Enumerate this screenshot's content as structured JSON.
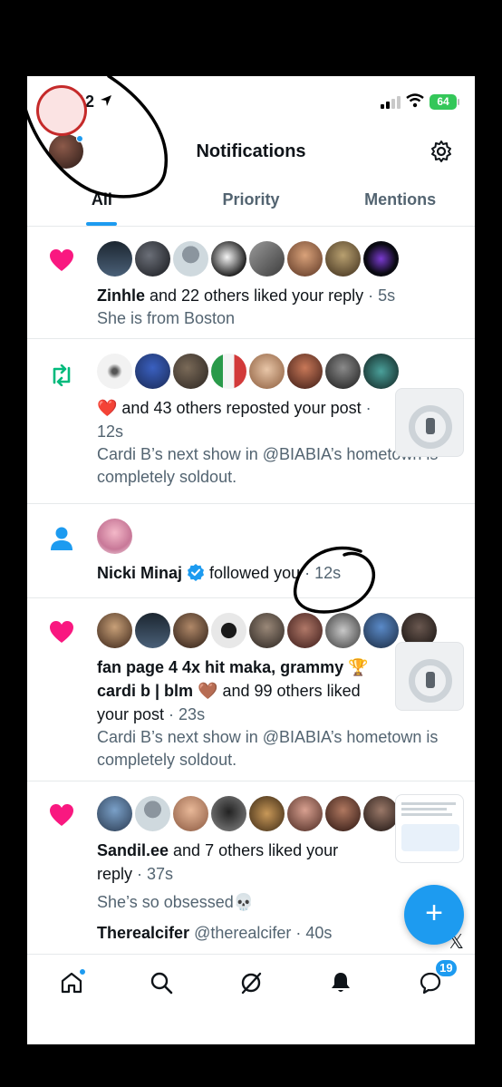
{
  "status_bar": {
    "time": "17:12",
    "battery": "64"
  },
  "header": {
    "title": "Notifications"
  },
  "tabs": [
    {
      "label": "All",
      "active": true
    },
    {
      "label": "Priority",
      "active": false
    },
    {
      "label": "Mentions",
      "active": false
    }
  ],
  "notifications": [
    {
      "type": "like",
      "icon": "heart-icon",
      "actor": "Zinhle",
      "text": " and 22 others liked your reply",
      "time": "5s",
      "sub": "She is from Boston"
    },
    {
      "type": "repost",
      "icon": "repost-icon",
      "actor": "❤️",
      "text": " and 43 others reposted your post",
      "time": "12s",
      "sub": "Cardi B’s next show in @BIABIA’s hometown is completely soldout."
    },
    {
      "type": "follow",
      "icon": "person-icon",
      "actor": "Nicki Minaj",
      "text": " followed you",
      "time": "12s"
    },
    {
      "type": "like",
      "icon": "heart-icon",
      "actor": "fan page 4 4x hit maka, grammy 🏆 cardi b | blm 🤎",
      "text": " and 99 others liked your post",
      "time": "23s",
      "sub": "Cardi B’s next show in @BIABIA’s hometown is completely soldout."
    },
    {
      "type": "like",
      "icon": "heart-icon",
      "actor": "Sandil.ee",
      "text": " and 7 others liked your reply",
      "time": "37s",
      "sub": "She’s so obsessed💀"
    }
  ],
  "peek_post": {
    "name": "Therealcifer",
    "handle": "@therealcifer",
    "time": "40s"
  },
  "fab": {
    "label": "+"
  },
  "bottom_nav": {
    "messages_badge": "19"
  },
  "colors": {
    "accent": "#1d9bf0",
    "like": "#f91880",
    "repost": "#00ba7c"
  }
}
